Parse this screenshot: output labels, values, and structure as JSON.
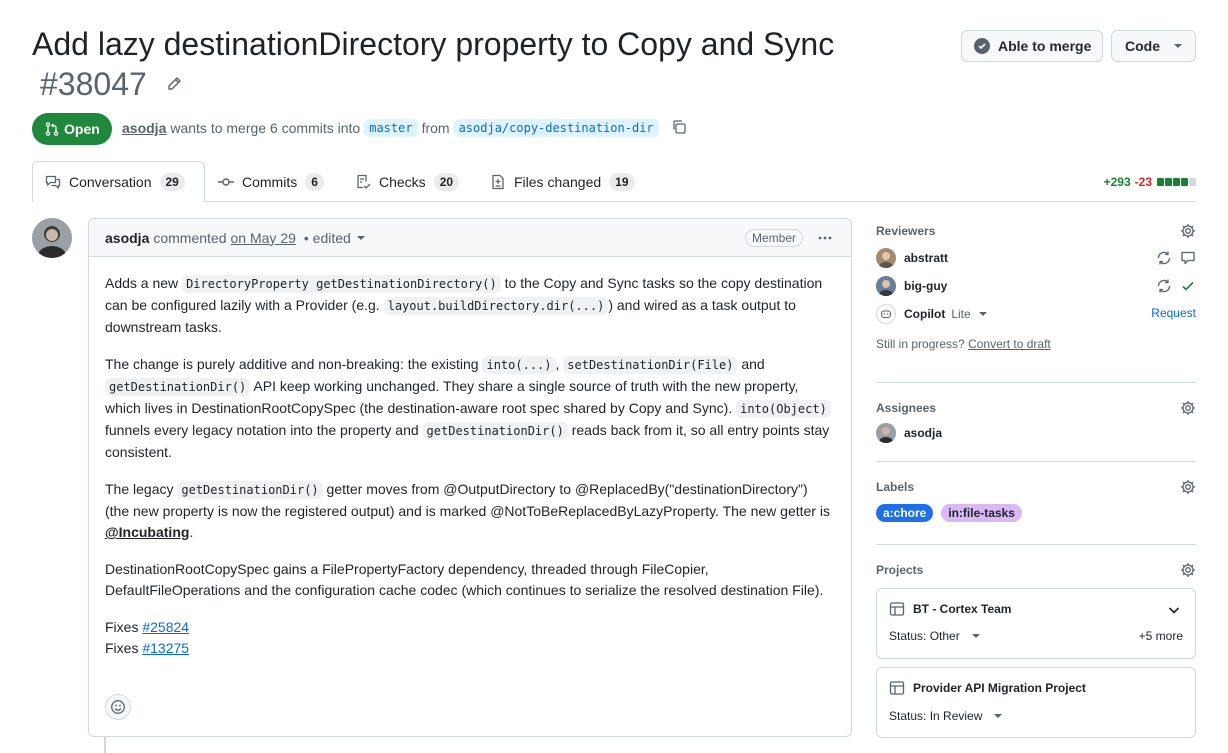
{
  "pr": {
    "title": "Add lazy destinationDirectory property to Copy and Sync",
    "number": "#38047",
    "state": "Open",
    "author": "asodja",
    "merge_text": "wants to merge 6 commits into",
    "base_branch": "master",
    "from_text": "from",
    "head_branch": "asodja/copy-destination-dir"
  },
  "header_actions": {
    "merge_label": "Able to merge",
    "code_label": "Code"
  },
  "tabs": [
    {
      "label": "Conversation",
      "count": "29"
    },
    {
      "label": "Commits",
      "count": "6"
    },
    {
      "label": "Checks",
      "count": "20"
    },
    {
      "label": "Files changed",
      "count": "19"
    }
  ],
  "diffstat": {
    "additions": "+293",
    "deletions": "-23"
  },
  "comment": {
    "author": "asodja",
    "action": "commented",
    "date": "on May 29",
    "edited": "• edited",
    "role": "Member",
    "p1_a": "Adds a new ",
    "p1_code1": "DirectoryProperty getDestinationDirectory()",
    "p1_b": " to the Copy and Sync tasks so the copy destination can be configured lazily with a Provider (e.g. ",
    "p1_code2": "layout.buildDirectory.dir(...)",
    "p1_c": ") and wired as a task output to downstream tasks.",
    "p2_a": "The change is purely additive and non-breaking: the existing ",
    "p2_code1": "into(...)",
    "p2_b": ", ",
    "p2_code2": "setDestinationDir(File)",
    "p2_c": " and ",
    "p2_code3": "getDestinationDir()",
    "p2_d": " API keep working unchanged. They share a single source of truth with the new property, which lives in DestinationRootCopySpec (the destination-aware root spec shared by Copy and Sync). ",
    "p2_code4": "into(Object)",
    "p2_e": " funnels every legacy notation into the property and ",
    "p2_code5": "getDestinationDir()",
    "p2_f": " reads back from it, so all entry points stay consistent.",
    "p3_a": "The legacy ",
    "p3_code1": "getDestinationDir()",
    "p3_b": " getter moves from @OutputDirectory to @ReplacedBy(\"destinationDirectory\") (the new property is now the registered output) and is marked @NotToBeReplacedByLazyProperty. The new getter is ",
    "p3_bold": "@Incubating",
    "p3_c": ".",
    "p4": "DestinationRootCopySpec gains a FilePropertyFactory dependency, threaded through FileCopier, DefaultFileOperations and the configuration cache codec (which continues to serialize the resolved destination File).",
    "fixes_label": "Fixes",
    "fix1": "#25824",
    "fix2": "#13275"
  },
  "sidebar": {
    "reviewers_title": "Reviewers",
    "reviewers": [
      {
        "name": "abstratt"
      },
      {
        "name": "big-guy"
      },
      {
        "name": "Copilot",
        "tag": "Lite",
        "action": "Request"
      }
    ],
    "still_in_progress": "Still in progress?",
    "convert_to_draft": "Convert to draft",
    "assignees_title": "Assignees",
    "assignee": "asodja",
    "labels_title": "Labels",
    "labels": [
      {
        "name": "a:chore",
        "color": "#1f6feb",
        "text": "#ffffff"
      },
      {
        "name": "in:file-tasks",
        "color": "#d8b9f5",
        "text": "#1f2328"
      }
    ],
    "projects_title": "Projects",
    "projects": [
      {
        "name": "BT - Cortex Team",
        "status": "Status: Other",
        "more": "+5 more"
      },
      {
        "name": "Provider API Migration Project",
        "status": "Status: In Review"
      }
    ]
  },
  "colors": {
    "open_green": "#1f883d",
    "link_blue": "#0969da",
    "add_green": "#1a7f37",
    "del_red": "#d1242f"
  }
}
